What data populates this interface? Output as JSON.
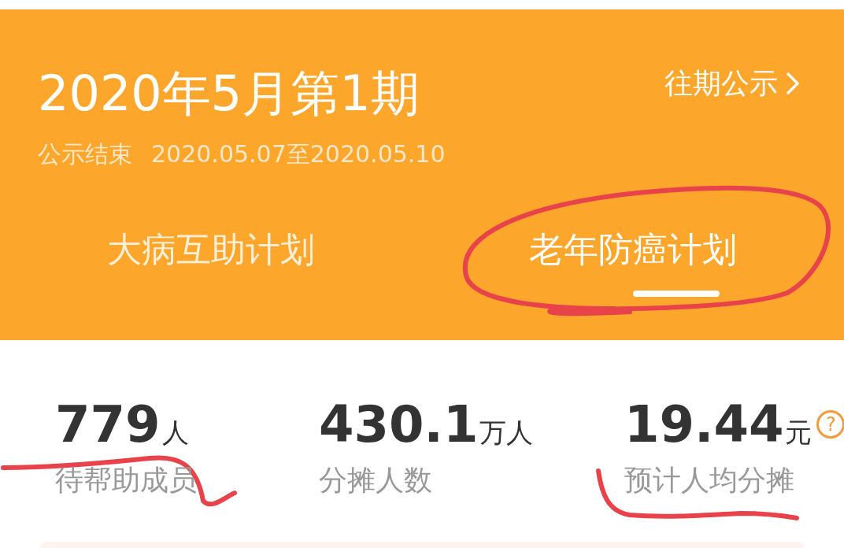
{
  "header": {
    "title": "2020年5月第1期",
    "status": "公示结束",
    "period": "2020.05.07至2020.05.10",
    "history_link": "往期公示"
  },
  "tabs": [
    {
      "label": "大病互助计划",
      "selected": false
    },
    {
      "label": "老年防癌计划",
      "selected": true
    }
  ],
  "stats": [
    {
      "value": "779",
      "unit": "人",
      "label": "待帮助成员",
      "help": false
    },
    {
      "value": "430.1",
      "unit": "万人",
      "label": "分摊人数",
      "help": false
    },
    {
      "value": "19.44",
      "unit": "元",
      "label": "预计人均分摊",
      "help": true
    }
  ],
  "help_mark": "?"
}
